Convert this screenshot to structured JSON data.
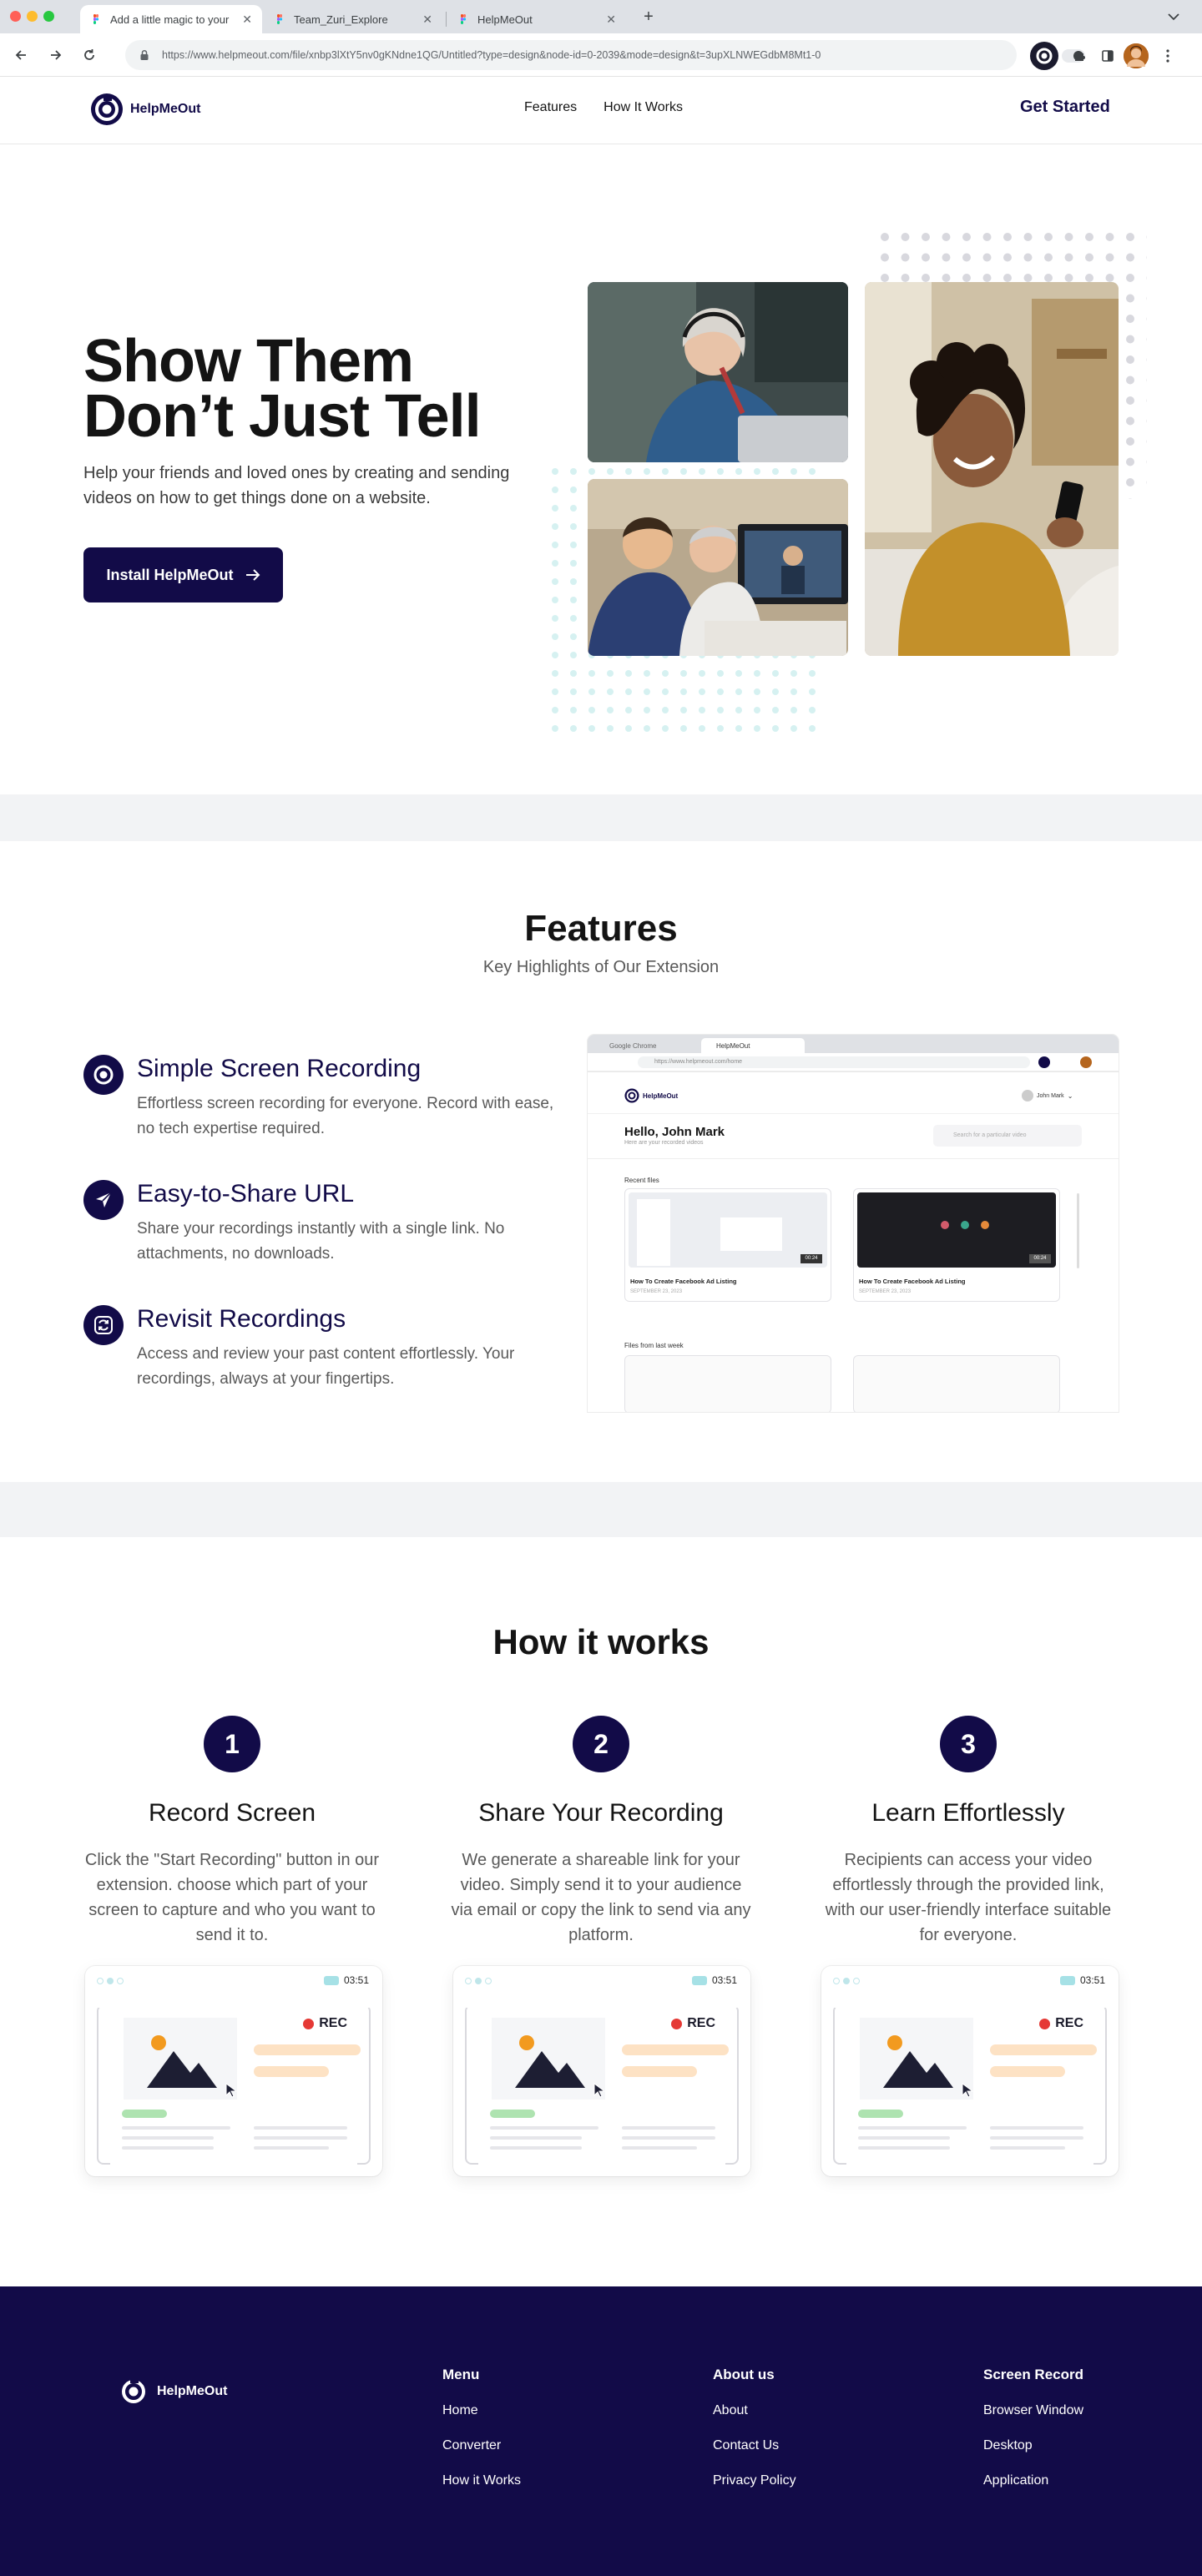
{
  "browser": {
    "tabs": [
      {
        "title": "Add a little magic to your",
        "active": true
      },
      {
        "title": "Team_Zuri_Explore",
        "active": false
      },
      {
        "title": "HelpMeOut",
        "active": false
      }
    ],
    "url": "https://www.helpmeout.com/file/xnbp3lXtY5nv0gKNdne1QG/Untitled?type=design&node-id=0-2039&mode=design&t=3upXLNWEGdbM8Mt1-0"
  },
  "header": {
    "logo_text": "HelpMeOut",
    "nav": [
      "Features",
      "How It Works"
    ],
    "cta": "Get Started"
  },
  "hero": {
    "title_line1": "Show Them",
    "title_line2": "Don’t Just Tell",
    "subtitle": "Help your friends and loved ones by creating and sending videos on how to get things done on a website.",
    "button": "Install HelpMeOut"
  },
  "features": {
    "title": "Features",
    "subtitle": "Key Highlights of Our Extension",
    "items": [
      {
        "title": "Simple Screen Recording",
        "desc": "Effortless screen recording for everyone. Record with ease, no tech expertise required.",
        "icon": "record-icon"
      },
      {
        "title": "Easy-to-Share URL",
        "desc": "Share your recordings instantly with a single link. No attachments, no downloads.",
        "icon": "send-icon"
      },
      {
        "title": "Revisit Recordings",
        "desc": "Access and review your past content effortlessly. Your recordings, always at your fingertips.",
        "icon": "refresh-icon"
      }
    ],
    "mock": {
      "tab1": "Google Chrome",
      "tab2": "HelpMeOut",
      "url": "https://www.helpmeout.com/home",
      "logo": "HelpMeOut",
      "user": "John Mark",
      "greeting": "Hello, John Mark",
      "greeting_sub": "Here are your recorded videos",
      "search_placeholder": "Search for a particular video",
      "recent": "Recent files",
      "card_title": "How To Create Facebook Ad Listing",
      "card_date": "SEPTEMBER 23, 2023",
      "card_time": "00:24",
      "last_week": "Files from last week"
    }
  },
  "how": {
    "title": "How it works",
    "steps": [
      {
        "num": "1",
        "title": "Record Screen",
        "desc": "Click the \"Start Recording\" button in our extension.  choose which part of your screen to capture and who you want to send it to."
      },
      {
        "num": "2",
        "title": "Share Your Recording",
        "desc": "We generate a shareable link for your video. Simply send it to your audience via email or copy the link to send via any platform."
      },
      {
        "num": "3",
        "title": "Learn Effortlessly",
        "desc": "Recipients can access your video effortlessly through the provided link, with our user-friendly interface suitable for everyone."
      }
    ],
    "card_time": "03:51",
    "card_rec": "REC"
  },
  "footer": {
    "logo_text": "HelpMeOut",
    "columns": [
      {
        "head": "Menu",
        "links": [
          "Home",
          "Converter",
          "How it Works"
        ]
      },
      {
        "head": "About us",
        "links": [
          "About",
          "Contact Us",
          "Privacy Policy"
        ]
      },
      {
        "head": "Screen Record",
        "links": [
          "Browser Window",
          "Desktop",
          "Application"
        ]
      }
    ]
  },
  "colors": {
    "brand": "#120b48",
    "band": "#f2f3f5",
    "rec_red": "#e53935",
    "accent_orange": "#f29a1f"
  }
}
